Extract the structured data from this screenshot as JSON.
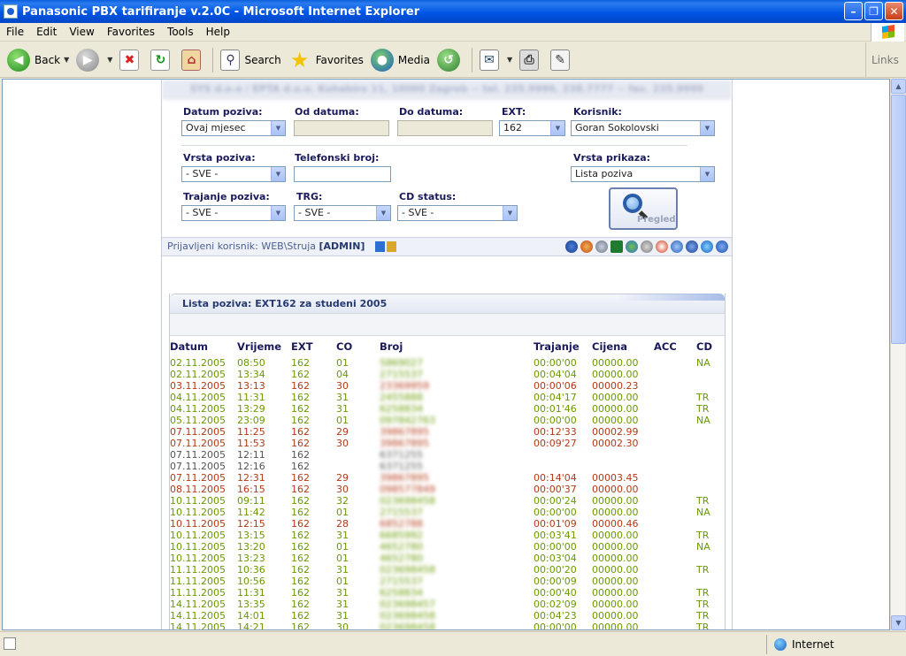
{
  "window": {
    "title": "Panasonic PBX tarifiranje v.2.0C - Microsoft Internet Explorer"
  },
  "menu": [
    "File",
    "Edit",
    "View",
    "Favorites",
    "Tools",
    "Help"
  ],
  "toolbar": {
    "back": "Back",
    "search": "Search",
    "favorites": "Favorites",
    "media": "Media",
    "links": "Links"
  },
  "status": {
    "zone": "Internet"
  },
  "header_text": "SYS d.o.o / EPTA d.o.o. Kuhabiro 11, 10000 Zagreb -- tel. 235.9999, 238.7777 -- fax. 235.9999",
  "filters": {
    "datum_poziva": {
      "label": "Datum poziva:",
      "value": "Ovaj mjesec"
    },
    "od_datuma": {
      "label": "Od datuma:"
    },
    "do_datuma": {
      "label": "Do datuma:"
    },
    "ext": {
      "label": "EXT:",
      "value": "162"
    },
    "korisnik": {
      "label": "Korisnik:",
      "value": "Goran Sokolovski"
    },
    "vrsta_poziva": {
      "label": "Vrsta poziva:",
      "value": "- SVE -"
    },
    "telefonski_broj": {
      "label": "Telefonski broj:"
    },
    "vrsta_prikaza": {
      "label": "Vrsta prikaza:",
      "value": "Lista poziva"
    },
    "trajanje_poziva": {
      "label": "Trajanje poziva:",
      "value": "- SVE -"
    },
    "trg": {
      "label": "TRG:",
      "value": "- SVE -"
    },
    "cd_status": {
      "label": "CD status:",
      "value": "- SVE -"
    },
    "pregled_label": "Pregled"
  },
  "login": {
    "prefix": "Prijavljeni korisnik: WEB\\Struja",
    "role": "[ADMIN]"
  },
  "list": {
    "title": "Lista poziva: EXT162 za studeni 2005",
    "columns": [
      "Datum",
      "Vrijeme",
      "EXT",
      "CO",
      "Broj",
      "Trajanje",
      "Cijena",
      "ACC",
      "CD"
    ],
    "rows": [
      {
        "d": "02.11.2005",
        "t": "08:50",
        "e": "162",
        "co": "01",
        "b": "5869027",
        "tr": "00:00'00",
        "c": "00000.00",
        "acc": "",
        "cd": "NA",
        "k": "green"
      },
      {
        "d": "02.11.2005",
        "t": "13:34",
        "e": "162",
        "co": "04",
        "b": "2715537",
        "tr": "00:04'04",
        "c": "00000.00",
        "acc": "",
        "cd": "",
        "k": "green"
      },
      {
        "d": "03.11.2005",
        "t": "13:13",
        "e": "162",
        "co": "30",
        "b": "23369959",
        "tr": "00:00'06",
        "c": "00000.23",
        "acc": "",
        "cd": "",
        "k": "red"
      },
      {
        "d": "04.11.2005",
        "t": "11:31",
        "e": "162",
        "co": "31",
        "b": "2455888",
        "tr": "00:04'17",
        "c": "00000.00",
        "acc": "",
        "cd": "TR",
        "k": "green"
      },
      {
        "d": "04.11.2005",
        "t": "13:29",
        "e": "162",
        "co": "31",
        "b": "6258834",
        "tr": "00:01'46",
        "c": "00000.00",
        "acc": "",
        "cd": "TR",
        "k": "green"
      },
      {
        "d": "05.11.2005",
        "t": "23:09",
        "e": "162",
        "co": "01",
        "b": "097842763",
        "tr": "00:00'00",
        "c": "00000.00",
        "acc": "",
        "cd": "NA",
        "k": "green"
      },
      {
        "d": "07.11.2005",
        "t": "11:25",
        "e": "162",
        "co": "29",
        "b": "39867895",
        "tr": "00:12'33",
        "c": "00002.99",
        "acc": "",
        "cd": "",
        "k": "red"
      },
      {
        "d": "07.11.2005",
        "t": "11:53",
        "e": "162",
        "co": "30",
        "b": "39867895",
        "tr": "00:09'27",
        "c": "00002.30",
        "acc": "",
        "cd": "",
        "k": "red"
      },
      {
        "d": "07.11.2005",
        "t": "12:11",
        "e": "162",
        "co": "",
        "b": "6371255",
        "tr": "",
        "c": "",
        "acc": "",
        "cd": "",
        "k": "dark"
      },
      {
        "d": "07.11.2005",
        "t": "12:16",
        "e": "162",
        "co": "",
        "b": "6371255",
        "tr": "",
        "c": "",
        "acc": "",
        "cd": "",
        "k": "dark"
      },
      {
        "d": "07.11.2005",
        "t": "12:31",
        "e": "162",
        "co": "29",
        "b": "39867895",
        "tr": "00:14'04",
        "c": "00003.45",
        "acc": "",
        "cd": "",
        "k": "red"
      },
      {
        "d": "08.11.2005",
        "t": "16:15",
        "e": "162",
        "co": "30",
        "b": "098577849",
        "tr": "00:00'37",
        "c": "00000.00",
        "acc": "",
        "cd": "",
        "k": "red"
      },
      {
        "d": "10.11.2005",
        "t": "09:11",
        "e": "162",
        "co": "32",
        "b": "023698458",
        "tr": "00:00'24",
        "c": "00000.00",
        "acc": "",
        "cd": "TR",
        "k": "green"
      },
      {
        "d": "10.11.2005",
        "t": "11:42",
        "e": "162",
        "co": "01",
        "b": "2715537",
        "tr": "00:00'00",
        "c": "00000.00",
        "acc": "",
        "cd": "NA",
        "k": "green"
      },
      {
        "d": "10.11.2005",
        "t": "12:15",
        "e": "162",
        "co": "28",
        "b": "6852788",
        "tr": "00:01'09",
        "c": "00000.46",
        "acc": "",
        "cd": "",
        "k": "red"
      },
      {
        "d": "10.11.2005",
        "t": "13:15",
        "e": "162",
        "co": "31",
        "b": "6685992",
        "tr": "00:03'41",
        "c": "00000.00",
        "acc": "",
        "cd": "TR",
        "k": "green"
      },
      {
        "d": "10.11.2005",
        "t": "13:20",
        "e": "162",
        "co": "01",
        "b": "4652780",
        "tr": "00:00'00",
        "c": "00000.00",
        "acc": "",
        "cd": "NA",
        "k": "green"
      },
      {
        "d": "10.11.2005",
        "t": "13:23",
        "e": "162",
        "co": "01",
        "b": "4652780",
        "tr": "00:03'04",
        "c": "00000.00",
        "acc": "",
        "cd": "",
        "k": "green"
      },
      {
        "d": "11.11.2005",
        "t": "10:36",
        "e": "162",
        "co": "31",
        "b": "023698458",
        "tr": "00:00'20",
        "c": "00000.00",
        "acc": "",
        "cd": "TR",
        "k": "green"
      },
      {
        "d": "11.11.2005",
        "t": "10:56",
        "e": "162",
        "co": "01",
        "b": "2715537",
        "tr": "00:00'09",
        "c": "00000.00",
        "acc": "",
        "cd": "",
        "k": "green"
      },
      {
        "d": "11.11.2005",
        "t": "11:31",
        "e": "162",
        "co": "31",
        "b": "6258834",
        "tr": "00:00'40",
        "c": "00000.00",
        "acc": "",
        "cd": "TR",
        "k": "green"
      },
      {
        "d": "14.11.2005",
        "t": "13:35",
        "e": "162",
        "co": "31",
        "b": "023698457",
        "tr": "00:02'09",
        "c": "00000.00",
        "acc": "",
        "cd": "TR",
        "k": "green"
      },
      {
        "d": "14.11.2005",
        "t": "14:01",
        "e": "162",
        "co": "31",
        "b": "023698458",
        "tr": "00:04'23",
        "c": "00000.00",
        "acc": "",
        "cd": "TR",
        "k": "green"
      },
      {
        "d": "14.11.2005",
        "t": "14:21",
        "e": "162",
        "co": "30",
        "b": "023698458",
        "tr": "00:00'00",
        "c": "00000.00",
        "acc": "",
        "cd": "TR",
        "k": "green"
      }
    ]
  }
}
